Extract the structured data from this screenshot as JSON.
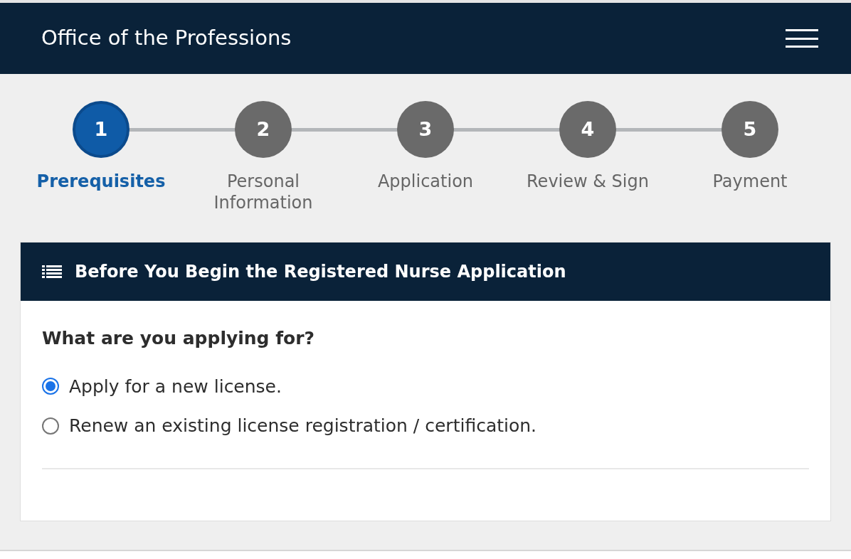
{
  "header": {
    "title": "Office of the Professions"
  },
  "steps": [
    {
      "number": "1",
      "label": "Prerequisites",
      "selected": true
    },
    {
      "number": "2",
      "label": "Personal Information",
      "selected": false
    },
    {
      "number": "3",
      "label": "Application",
      "selected": false
    },
    {
      "number": "4",
      "label": "Review & Sign",
      "selected": false
    },
    {
      "number": "5",
      "label": "Payment",
      "selected": false
    }
  ],
  "panel": {
    "title": "Before You Begin the Registered Nurse Application",
    "question": "What are you applying for?",
    "options": [
      {
        "label": "Apply for a new license.",
        "selected": true
      },
      {
        "label": "Renew an existing license registration / certification.",
        "selected": false
      }
    ]
  }
}
